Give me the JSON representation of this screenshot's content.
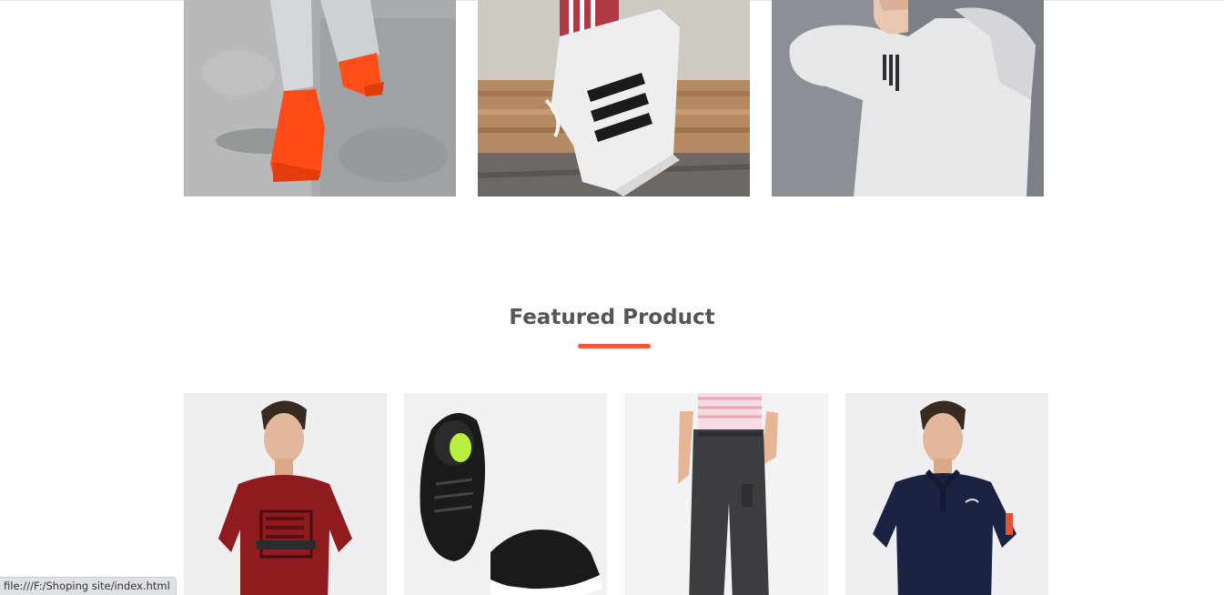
{
  "featured": {
    "title": "Featured Product",
    "accent_color": "#ff523b"
  },
  "categories": [
    {
      "name": "red-sneakers"
    },
    {
      "name": "adidas-superstar"
    },
    {
      "name": "adidas-hoodie"
    }
  ],
  "products": [
    {
      "name": "red-puma-tshirt",
      "shirt_color": "#8f1b1f"
    },
    {
      "name": "black-hrx-shoes",
      "shoe_color": "#1a1a1a"
    },
    {
      "name": "grey-joggers",
      "pant_color": "#3c3d40"
    },
    {
      "name": "navy-puma-polo",
      "shirt_color": "#1c2241"
    }
  ],
  "status_bar": {
    "url": "file:///F:/Shoping site/index.html"
  }
}
